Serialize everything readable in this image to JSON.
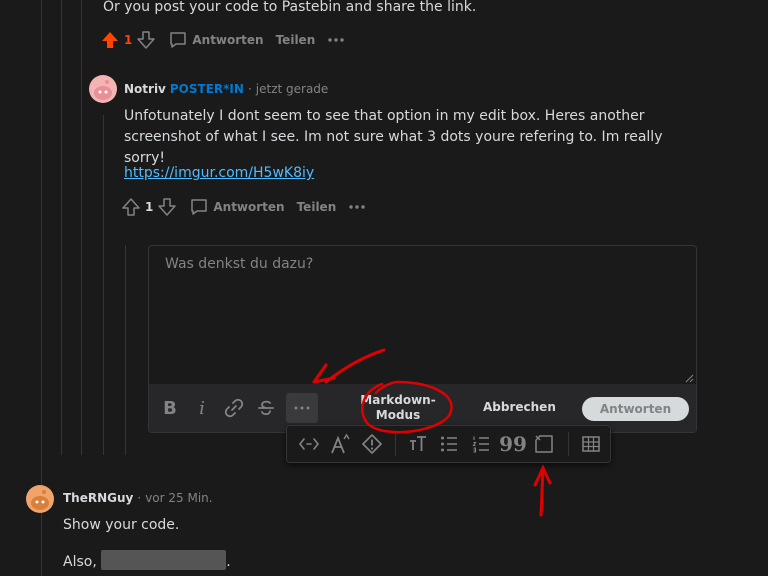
{
  "top_comment": {
    "text": "Or you post your code to Pastebin and share the link.",
    "vote_count": "1",
    "reply_label": "Antworten",
    "share_label": "Teilen"
  },
  "reply": {
    "author": "Notriv",
    "flair": "POSTER*IN",
    "separator": "·",
    "time": "jetzt gerade",
    "text": "Unfotunately I dont seem to see that option in my edit box. Heres another screenshot of what I see. Im not sure what 3 dots youre refering to. Im really sorry!",
    "link": "https://imgur.com/H5wK8iy",
    "vote_count": "1",
    "reply_label": "Antworten",
    "share_label": "Teilen"
  },
  "editor": {
    "placeholder": "Was denkst du dazu?",
    "markdown_line1": "Markdown-",
    "markdown_line2": "Modus",
    "cancel_label": "Abbrechen",
    "submit_label": "Antworten",
    "toolbar_icons": [
      "bold-icon",
      "italic-icon",
      "link-icon",
      "strikethrough-icon",
      "more-options-icon"
    ],
    "popup_icons": [
      "inline-code-icon",
      "superscript-icon",
      "spoiler-icon",
      "heading-icon",
      "bulleted-list-icon",
      "numbered-list-icon",
      "quote-block-icon",
      "code-block-icon",
      "table-icon"
    ]
  },
  "bottom_comment": {
    "author": "TheRNGuy",
    "separator": "·",
    "time": "vor 25 Min.",
    "text": "Show your code.",
    "also_text": "Also,",
    "period": "."
  },
  "colors": {
    "background": "#1a1a1b",
    "upvote_active": "#ff4500",
    "flair": "#0079d3",
    "link": "#4fbcff",
    "annotation": "#e00000"
  }
}
